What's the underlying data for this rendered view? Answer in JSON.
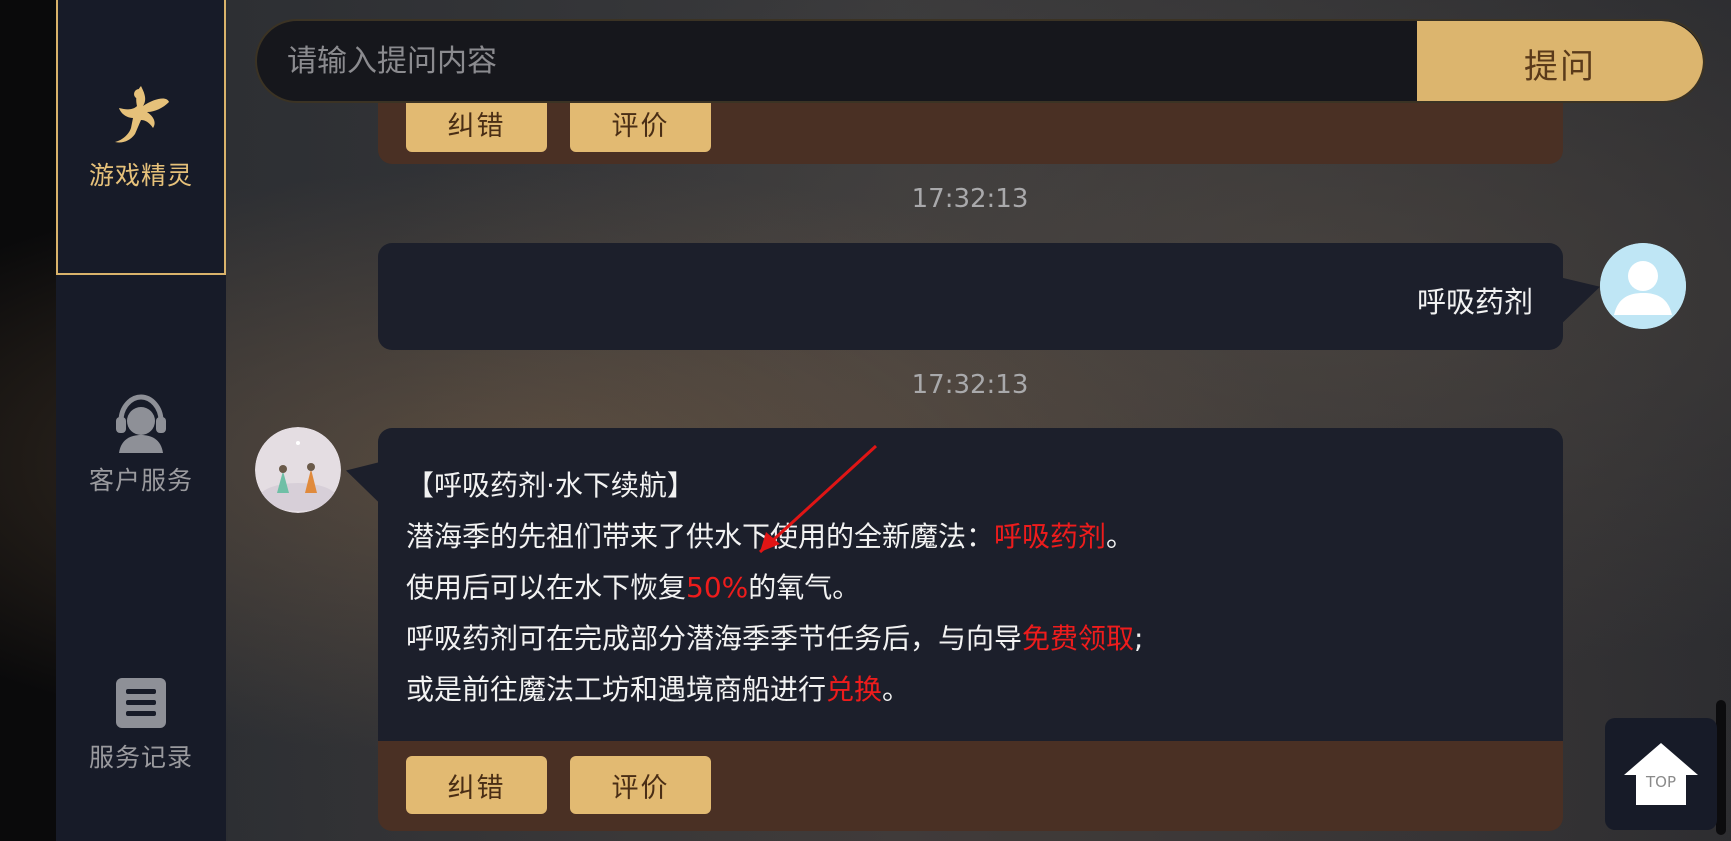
{
  "sidebar": {
    "items": [
      {
        "label": "游戏精灵",
        "icon": "fairy-icon",
        "active": true
      },
      {
        "label": "客户服务",
        "icon": "customer-service-icon",
        "active": false
      },
      {
        "label": "服务记录",
        "icon": "records-icon",
        "active": false
      }
    ]
  },
  "search": {
    "placeholder": "请输入提问内容",
    "submit_label": "提问"
  },
  "chat": {
    "prev_footer": {
      "correct_label": "纠错",
      "rate_label": "评价"
    },
    "messages": [
      {
        "time": "17:32:13",
        "sender": "user",
        "text": "呼吸药剂"
      },
      {
        "time": "17:32:13",
        "sender": "bot",
        "lines": {
          "l1": "【呼吸药剂·水下续航】",
          "l2a": "潜海季的先祖们带来了供水下使用的全新魔法：",
          "l2b": "呼吸药剂",
          "l2c": "。",
          "l3a": "使用后可以在水下恢复",
          "l3b": "50%",
          "l3c": "的氧气。",
          "l4a": "呼吸药剂可在完成部分潜海季季节任务后，与向导",
          "l4b": "免费领取",
          "l4c": ";",
          "l5a": "或是前往魔法工坊和遇境商船进行",
          "l5b": "兑换",
          "l5c": "。"
        },
        "correct_label": "纠错",
        "rate_label": "评价"
      }
    ]
  },
  "top_button": {
    "label": "TOP",
    "icon": "house-up-icon"
  },
  "colors": {
    "accent": "#dcb56e",
    "highlight": "#ee1c1c",
    "sidebar_bg": "#171b28",
    "bubble_bg": "#1c1f2b",
    "footer_bg": "#4a3024"
  }
}
